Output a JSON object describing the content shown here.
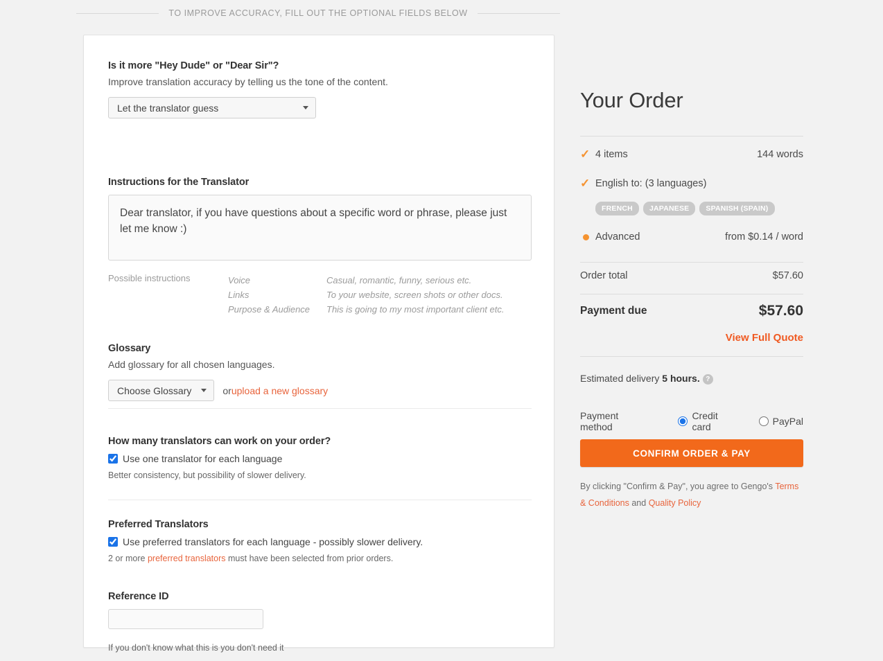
{
  "banner": {
    "text": "TO IMPROVE ACCURACY, FILL OUT THE OPTIONAL FIELDS BELOW"
  },
  "form": {
    "tone": {
      "heading": "Is it more \"Hey Dude\" or \"Dear Sir\"?",
      "subtitle": "Improve translation accuracy by telling us the tone of the content.",
      "selected": "Let the translator guess"
    },
    "instructions": {
      "heading": "Instructions for the Translator",
      "value": "Dear translator, if you have questions about a specific word or phrase, please just let me know :)",
      "possible_label": "Possible instructions",
      "possible_rows": [
        {
          "term": "Voice",
          "desc": "Casual, romantic, funny, serious etc."
        },
        {
          "term": "Links",
          "desc": "To your website, screen shots or other docs."
        },
        {
          "term": "Purpose & Audience",
          "desc": "This is going to my most important client etc."
        }
      ]
    },
    "glossary": {
      "heading": "Glossary",
      "subtitle": "Add glossary for all chosen languages.",
      "button_label": "Choose Glossary",
      "or_text": "or ",
      "upload_link": "upload a new glossary"
    },
    "translators_count": {
      "heading": "How many translators can work on your order?",
      "checkbox_label": "Use one translator for each language",
      "checked": true,
      "note": "Better consistency, but possibility of slower delivery."
    },
    "preferred": {
      "heading": "Preferred Translators",
      "checkbox_label": "Use preferred translators for each language - possibly slower delivery.",
      "checked": true,
      "note_prefix": "2 or more ",
      "note_link": "preferred translators",
      "note_suffix": " must have been selected from prior orders."
    },
    "reference": {
      "heading": "Reference ID",
      "value": "",
      "placeholder": "",
      "note": "If you don't know what this is you don't need it"
    }
  },
  "order": {
    "title": "Your Order",
    "items_label": "4 items",
    "words_label": "144 words",
    "languages_label": "English to: (3 languages)",
    "language_badges": [
      "FRENCH",
      "JAPANESE",
      "SPANISH (SPAIN)"
    ],
    "tier_label": "Advanced",
    "tier_price": "from $0.14 / word",
    "order_total_label": "Order total",
    "order_total_value": "$57.60",
    "payment_due_label": "Payment due",
    "payment_due_value": "$57.60",
    "view_quote_label": "View Full Quote",
    "eta_prefix": "Estimated delivery ",
    "eta_value": "5 hours.",
    "help_glyph": "?",
    "payment_method_label": "Payment method",
    "payment_options": [
      {
        "label": "Credit card",
        "selected": true
      },
      {
        "label": "PayPal",
        "selected": false
      }
    ],
    "cta_label": "CONFIRM ORDER & PAY",
    "legal_prefix": "By clicking \"Confirm & Pay\", you agree to Gengo's ",
    "legal_link1": "Terms & Conditions",
    "legal_mid": " and ",
    "legal_link2": "Quality Policy"
  },
  "colors": {
    "accent_orange": "#f2691b",
    "link_orange": "#e8643c",
    "check_orange": "#f59331",
    "page_bg": "#f2f2f2",
    "badge_gray": "#c9c9c9"
  }
}
